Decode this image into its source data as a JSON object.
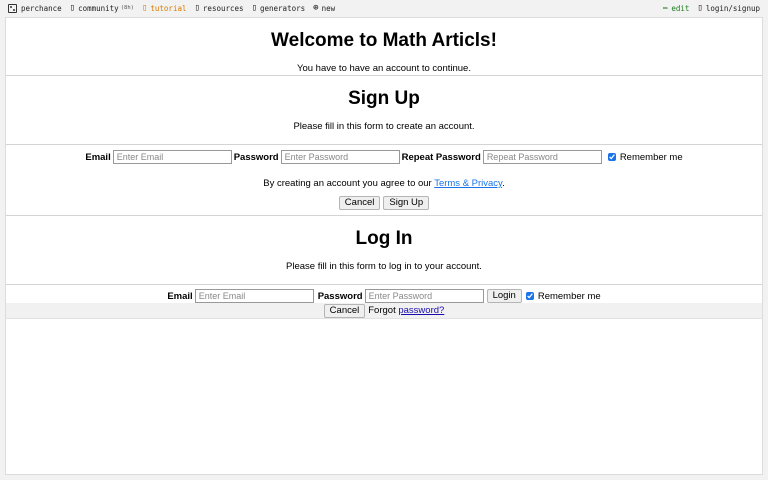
{
  "topbar": {
    "items": [
      {
        "label": "perchance"
      },
      {
        "label": "community",
        "badge": "(8h)"
      },
      {
        "label": "tutorial"
      },
      {
        "label": "resources"
      },
      {
        "label": "generators"
      },
      {
        "label": "new"
      }
    ],
    "edit": "edit",
    "login": "login/signup"
  },
  "welcome": {
    "title": "Welcome to Math Articls!",
    "subtitle": "You have to have an account to continue."
  },
  "signup": {
    "title": "Sign Up",
    "subtitle": "Please fill in this form to create an account.",
    "email_label": "Email",
    "email_placeholder": "Enter Email",
    "password_label": "Password",
    "password_placeholder": "Enter Password",
    "repeat_label": "Repeat Password",
    "repeat_placeholder": "Repeat Password",
    "remember_label": "Remember me",
    "remember_checked": true,
    "terms_prefix": "By creating an account you agree to our ",
    "terms_link": "Terms & Privacy",
    "terms_suffix": ".",
    "cancel": "Cancel",
    "submit": "Sign Up"
  },
  "login": {
    "title": "Log In",
    "subtitle": "Please fill in this form to log in to your account.",
    "email_label": "Email",
    "email_placeholder": "Enter Email",
    "password_label": "Password",
    "password_placeholder": "Enter Password",
    "submit": "Login",
    "remember_label": "Remember me",
    "remember_checked": true,
    "cancel": "Cancel",
    "forgot_prefix": "Forgot ",
    "forgot_link": "password?"
  }
}
